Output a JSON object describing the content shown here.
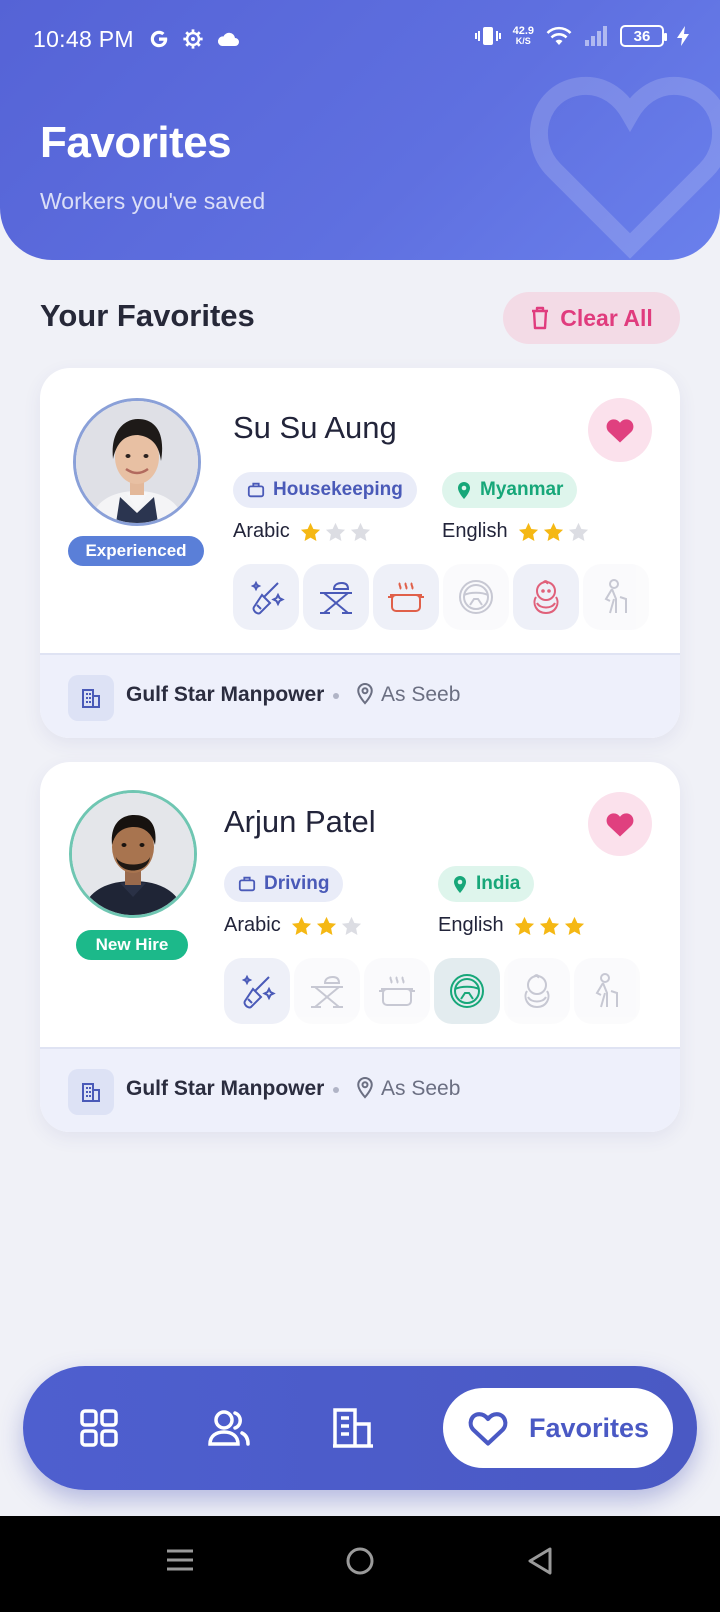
{
  "status": {
    "time": "10:48 PM",
    "netspeed_value": "42.9",
    "netspeed_unit": "K/S",
    "battery": "36"
  },
  "header": {
    "title": "Favorites",
    "subtitle": "Workers you've saved"
  },
  "section": {
    "title": "Your Favorites",
    "clear_label": "Clear All"
  },
  "workers": [
    {
      "name": "Su Su Aung",
      "badge": "Experienced",
      "category": "Housekeeping",
      "country": "Myanmar",
      "languages": [
        {
          "label": "Arabic",
          "rating": 1,
          "max": 3
        },
        {
          "label": "English",
          "rating": 2,
          "max": 3
        }
      ],
      "skills": [
        {
          "icon": "cleaning-icon",
          "active": true
        },
        {
          "icon": "ironing-icon",
          "active": true
        },
        {
          "icon": "cooking-icon",
          "active": true
        },
        {
          "icon": "driving-icon",
          "active": false
        },
        {
          "icon": "baby-care-icon",
          "active": true
        },
        {
          "icon": "elderly-care-icon",
          "active": false
        }
      ],
      "agency": "Gulf Star Manpower",
      "area": "As Seeb"
    },
    {
      "name": "Arjun Patel",
      "badge": "New Hire",
      "category": "Driving",
      "country": "India",
      "languages": [
        {
          "label": "Arabic",
          "rating": 2,
          "max": 3
        },
        {
          "label": "English",
          "rating": 3,
          "max": 3
        }
      ],
      "skills": [
        {
          "icon": "cleaning-icon",
          "active": true
        },
        {
          "icon": "ironing-icon",
          "active": false
        },
        {
          "icon": "cooking-icon",
          "active": false
        },
        {
          "icon": "driving-icon",
          "active": true
        },
        {
          "icon": "baby-care-icon",
          "active": false
        },
        {
          "icon": "elderly-care-icon",
          "active": false
        }
      ],
      "agency": "Gulf Star Manpower",
      "area": "As Seeb"
    }
  ],
  "nav": {
    "items": [
      {
        "icon": "dashboard-grid-icon"
      },
      {
        "icon": "workers-icon"
      },
      {
        "icon": "agencies-building-icon"
      }
    ],
    "active_label": "Favorites"
  },
  "colors": {
    "primary": "#5563d6",
    "accent_pink": "#e03c7e",
    "green": "#17a779",
    "star": "#f5b814"
  }
}
